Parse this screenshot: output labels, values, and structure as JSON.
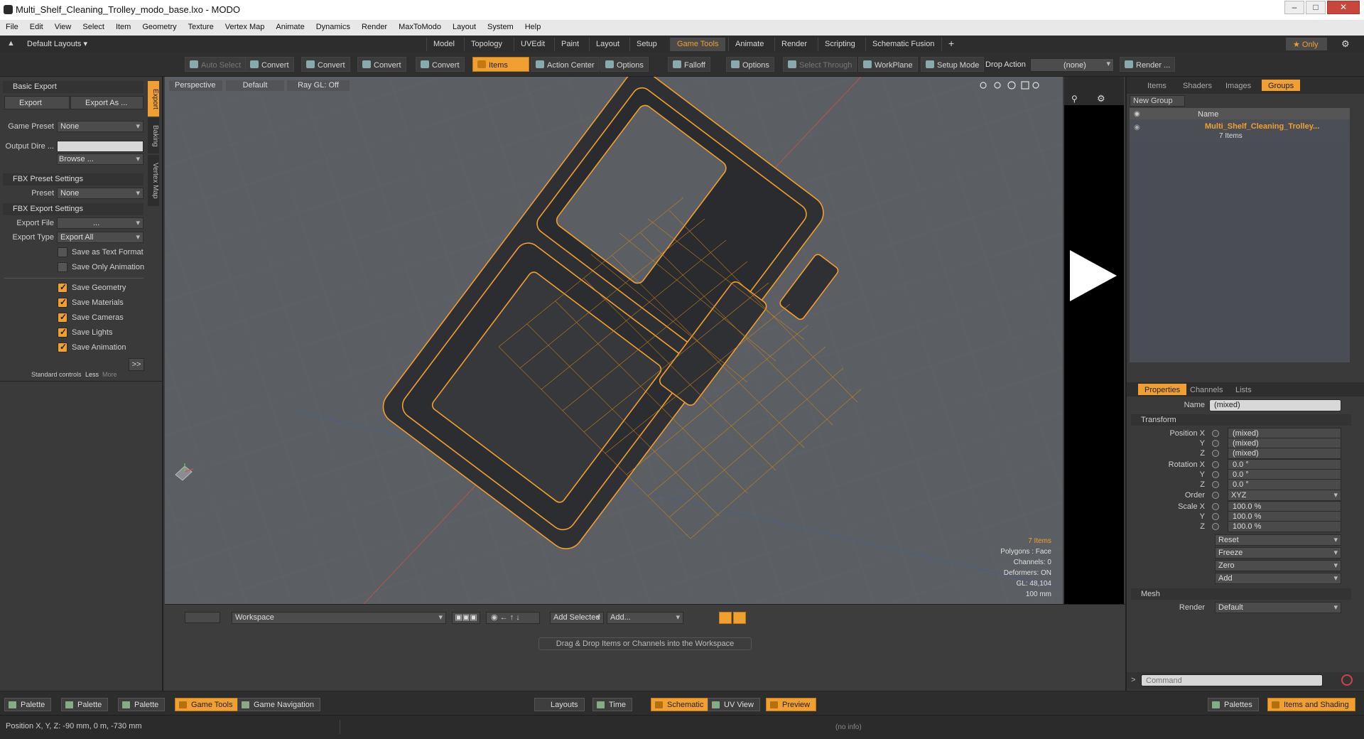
{
  "window": {
    "title": "Multi_Shelf_Cleaning_Trolley_modo_base.lxo - MODO"
  },
  "menu": [
    "File",
    "Edit",
    "View",
    "Select",
    "Item",
    "Geometry",
    "Texture",
    "Vertex Map",
    "Animate",
    "Dynamics",
    "Render",
    "MaxToModo",
    "Layout",
    "System",
    "Help"
  ],
  "layout_bar": {
    "default_layouts": "Default Layouts ▾",
    "tabs": [
      "Model",
      "Topology",
      "UVEdit",
      "Paint",
      "Layout",
      "Setup",
      "Game Tools",
      "Animate",
      "Render",
      "Scripting",
      "Schematic Fusion"
    ],
    "active_tab": "Game Tools",
    "plus": "+",
    "only": "★ Only"
  },
  "toolbar": {
    "auto_select": "Auto Select",
    "convert1": "Convert",
    "convert2": "Convert",
    "convert3": "Convert",
    "convert4": "Convert",
    "items": "Items",
    "action_center": "Action Center",
    "options1": "Options",
    "falloff": "Falloff",
    "options2": "Options",
    "select_through": "Select Through",
    "workplane": "WorkPlane",
    "setup_mode": "Setup Mode",
    "drop_action": "Drop Action",
    "drop_value": "(none)",
    "render": "Render ..."
  },
  "left_panel": {
    "basic_export": "Basic Export",
    "export_btn": "Export",
    "export_as_btn": "Export As ...",
    "game_preset_label": "Game Preset",
    "game_preset_value": "None",
    "output_dir_label": "Output Dire ...",
    "browse": "Browse ...",
    "fbx_preset_settings": "FBX Preset Settings",
    "preset_label": "Preset",
    "preset_value": "None",
    "fbx_export_settings": "FBX Export Settings",
    "export_file_label": "Export File",
    "export_file_value": "...",
    "export_type_label": "Export Type",
    "export_type_value": "Export All",
    "save_text": "Save as Text Format",
    "save_anim_only": "Save Only Animation",
    "save_geometry": "Save Geometry",
    "save_materials": "Save Materials",
    "save_cameras": "Save Cameras",
    "save_lights": "Save Lights",
    "save_animation": "Save Animation",
    "more_arrow": ">>",
    "standard_controls": "Standard controls",
    "less": "Less",
    "more": "More",
    "vtabs": [
      "Export",
      "Baking",
      "Vertex Map"
    ]
  },
  "viewport": {
    "perspective": "Perspective",
    "default": "Default",
    "raygl": "Ray GL: Off",
    "info": {
      "items": "7 Items",
      "polygons": "Polygons : Face",
      "channels": "Channels: 0",
      "deformers": "Deformers: ON",
      "gl": "GL: 48,104",
      "scale": "100 mm"
    }
  },
  "right_panel": {
    "top_tabs": [
      "Items",
      "Shaders",
      "Images",
      "Groups"
    ],
    "active_top_tab": "Groups",
    "new_group": "New Group",
    "name_col": "Name",
    "group_name": "Multi_Shelf_Cleaning_Trolley...",
    "group_items": "7 Items",
    "prop_tabs": [
      "Properties",
      "Channels",
      "Lists"
    ],
    "active_prop_tab": "Properties",
    "name_label": "Name",
    "name_value": "(mixed)",
    "transform": "Transform",
    "pos_x_label": "Position X",
    "y_label": "Y",
    "z_label": "Z",
    "pos_x": "(mixed)",
    "pos_y": "(mixed)",
    "pos_z": "(mixed)",
    "rot_x_label": "Rotation X",
    "rot_x": "0.0 °",
    "rot_y": "0.0 °",
    "rot_z": "0.0 °",
    "order_label": "Order",
    "order_value": "XYZ",
    "scale_x_label": "Scale X",
    "scale_x": "100.0 %",
    "scale_y": "100.0 %",
    "scale_z": "100.0 %",
    "reset": "Reset",
    "freeze": "Freeze",
    "zero": "Zero",
    "add": "Add",
    "mesh": "Mesh",
    "render_label": "Render",
    "render_value": "Default",
    "command_placeholder": "Command"
  },
  "schematic": {
    "workspace": "Workspace",
    "add_selected": "Add Selected",
    "add": "Add...",
    "hint": "Drag & Drop Items or Channels into the Workspace"
  },
  "bottom_bar": {
    "palette1": "Palette",
    "palette2": "Palette",
    "palette3": "Palette",
    "game_tools": "Game Tools",
    "game_navigation": "Game Navigation",
    "layouts": "Layouts",
    "time": "Time",
    "schematic": "Schematic",
    "uv_view": "UV View",
    "preview": "Preview",
    "palettes": "Palettes",
    "items_shading": "Items and Shading"
  },
  "status": {
    "position": "Position X, Y, Z:  -90 mm, 0 m, -730 mm",
    "info": "(no info)"
  },
  "colors": {
    "accent": "#f0a030",
    "wire": "#f0a030",
    "viewport_bg": "#5b5e62"
  }
}
